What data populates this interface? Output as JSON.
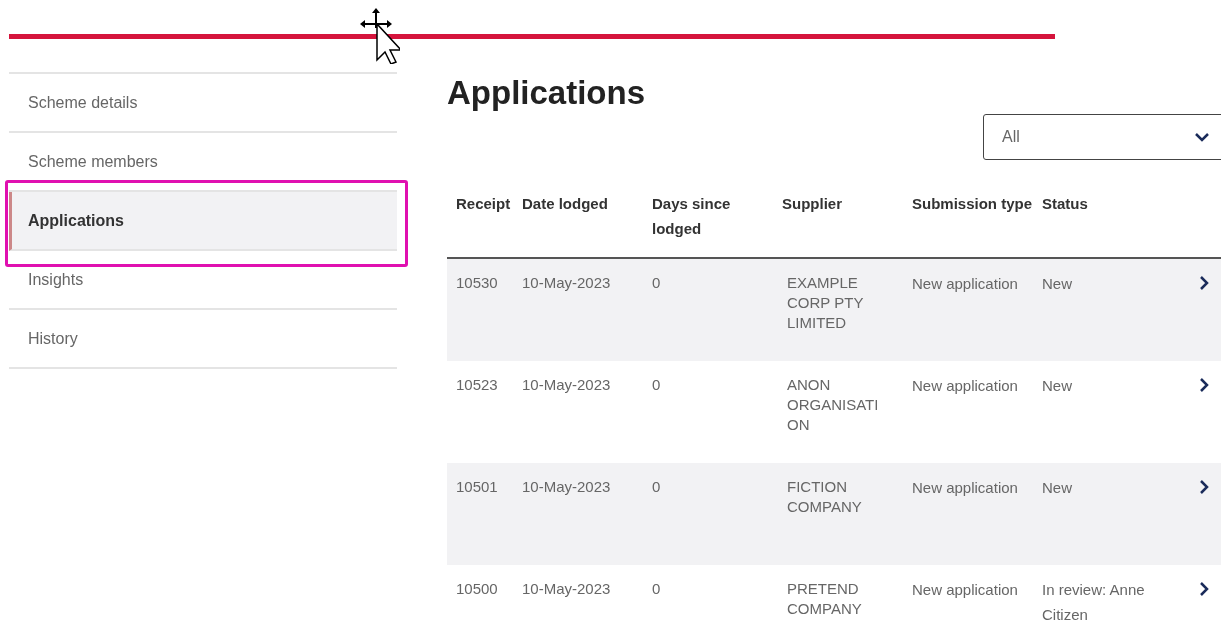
{
  "sidebar": {
    "items": [
      {
        "label": "Scheme details",
        "selected": false
      },
      {
        "label": "Scheme members",
        "selected": false
      },
      {
        "label": "Applications",
        "selected": true
      },
      {
        "label": "Insights",
        "selected": false
      },
      {
        "label": "History",
        "selected": false
      }
    ]
  },
  "heading": "Applications",
  "filter": {
    "value": "All"
  },
  "table": {
    "columns": [
      "Receipt",
      "Date lodged",
      "Days since lodged",
      "Supplier",
      "Submission type",
      "Status"
    ],
    "rows": [
      {
        "cells": [
          "10530",
          "10-May-2023",
          "0",
          "EXAMPLE CORP PTY LIMITED",
          "New application",
          "New"
        ]
      },
      {
        "cells": [
          "10523",
          "10-May-2023",
          "0",
          "ANON ORGANISATI ON",
          "New application",
          "New"
        ]
      },
      {
        "cells": [
          "10501",
          "10-May-2023",
          "0",
          "FICTION COMPANY",
          "New application",
          "New"
        ]
      },
      {
        "cells": [
          "10500",
          "10-May-2023",
          "0",
          "PRETEND COMPANY",
          "New application",
          "In review: Anne Citizen"
        ]
      }
    ]
  }
}
